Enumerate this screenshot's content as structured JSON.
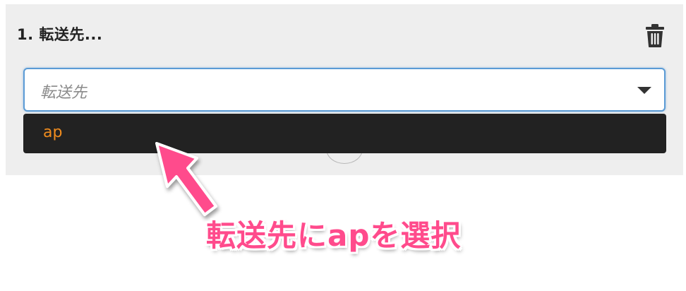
{
  "step": {
    "title": "1. 転送先..."
  },
  "select": {
    "placeholder": "転送先"
  },
  "dropdown": {
    "options": [
      {
        "label": "ap"
      }
    ]
  },
  "annotation": {
    "text": "転送先にapを選択",
    "color": "#ff4b8c"
  },
  "icons": {
    "delete": "trash-icon",
    "caret": "caret-down-icon"
  },
  "colors": {
    "panel_bg": "#eeeeee",
    "select_border": "#5b9bd5",
    "dropdown_bg": "#222222",
    "option_text": "#f08c1e"
  }
}
